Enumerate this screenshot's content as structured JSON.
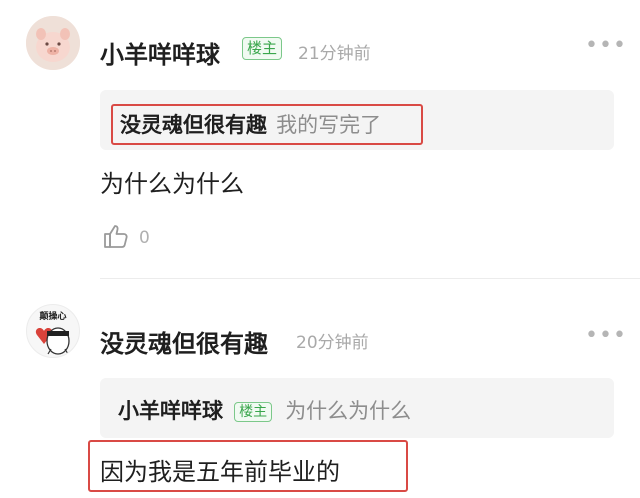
{
  "comments": [
    {
      "author": "小羊咩咩球",
      "badge": "楼主",
      "time": "21分钟前",
      "quote": {
        "author": "没灵魂但很有趣",
        "text": "我的写完了"
      },
      "body": "为什么为什么",
      "likes": "0"
    },
    {
      "author": "没灵魂但很有趣",
      "avatar_text": "颠操心",
      "time": "20分钟前",
      "quote": {
        "author": "小羊咩咩球",
        "badge": "楼主",
        "text": "为什么为什么"
      },
      "body": "因为我是五年前毕业的"
    }
  ],
  "more_icon": "more-horizontal-icon",
  "like_icon": "thumbs-up-icon",
  "colors": {
    "badge_green": "#3aa64c",
    "highlight_red": "#d94a45",
    "quote_bg": "#f4f4f4"
  }
}
